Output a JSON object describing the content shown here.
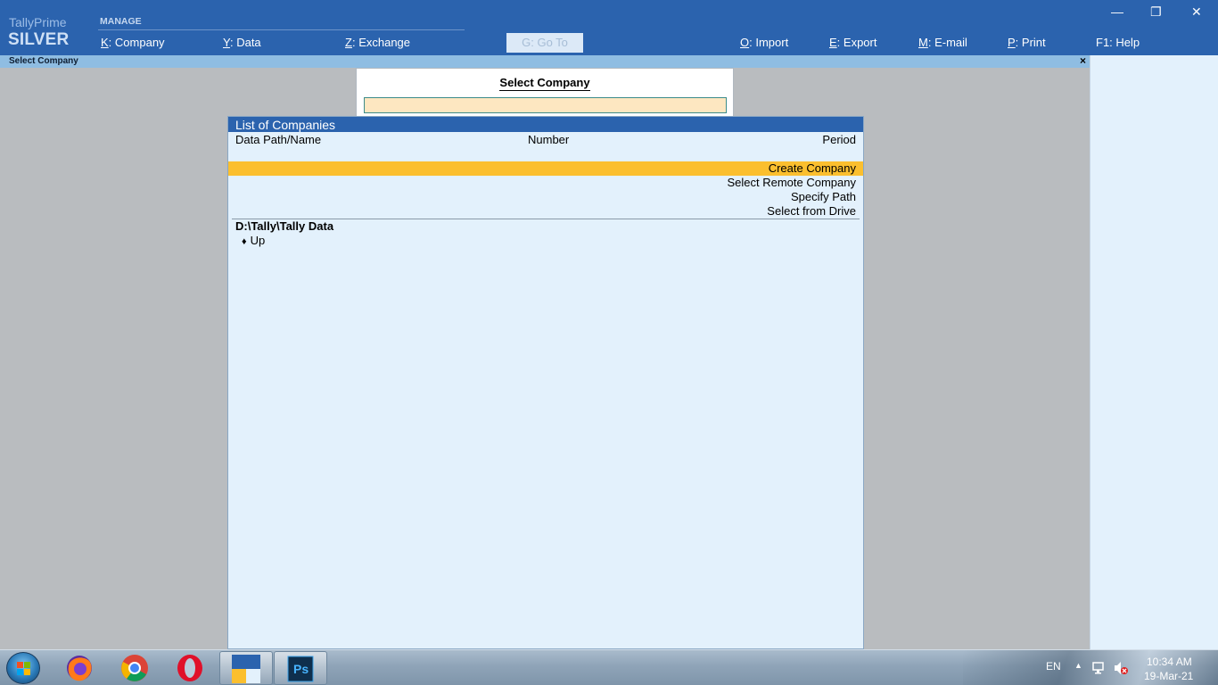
{
  "brand": {
    "name": "TallyPrime",
    "edition": "SILVER"
  },
  "menu": {
    "section": "MANAGE",
    "items": [
      {
        "key": "K",
        "label": "Company"
      },
      {
        "key": "Y",
        "label": "Data"
      },
      {
        "key": "Z",
        "label": "Exchange"
      },
      {
        "key": "G",
        "label": "Go To"
      },
      {
        "key": "O",
        "label": "Import"
      },
      {
        "key": "E",
        "label": "Export"
      },
      {
        "key": "M",
        "label": "E-mail"
      },
      {
        "key": "P",
        "label": "Print"
      },
      {
        "key": "F1",
        "label": "Help"
      }
    ]
  },
  "window_controls": {
    "minimize": "—",
    "restore": "❐",
    "close": "✕"
  },
  "subbar": {
    "title": "Select Company",
    "close": "×"
  },
  "select_box": {
    "title": "Select Company",
    "input_value": ""
  },
  "list": {
    "title": "List of Companies",
    "columns": [
      "Data Path/Name",
      "Number",
      "Period"
    ],
    "actions": [
      "Create Company",
      "Select Remote Company",
      "Specify Path",
      "Select from Drive"
    ],
    "data_path": "D:\\Tally\\Tally Data",
    "up_label": "Up"
  },
  "taskbar": {
    "apps": [
      "firefox-icon",
      "chrome-icon",
      "opera-icon",
      "tallyprime-icon",
      "photoshop-icon"
    ],
    "photoshop_label": "Ps",
    "tray_language": "EN",
    "time": "10:34 AM",
    "date": "19-Mar-21"
  },
  "colors": {
    "title_bar": "#2b63ae",
    "panel_bg": "#e3f1fc",
    "highlight": "#fbbf2e",
    "input_bg": "#fde7c1"
  }
}
